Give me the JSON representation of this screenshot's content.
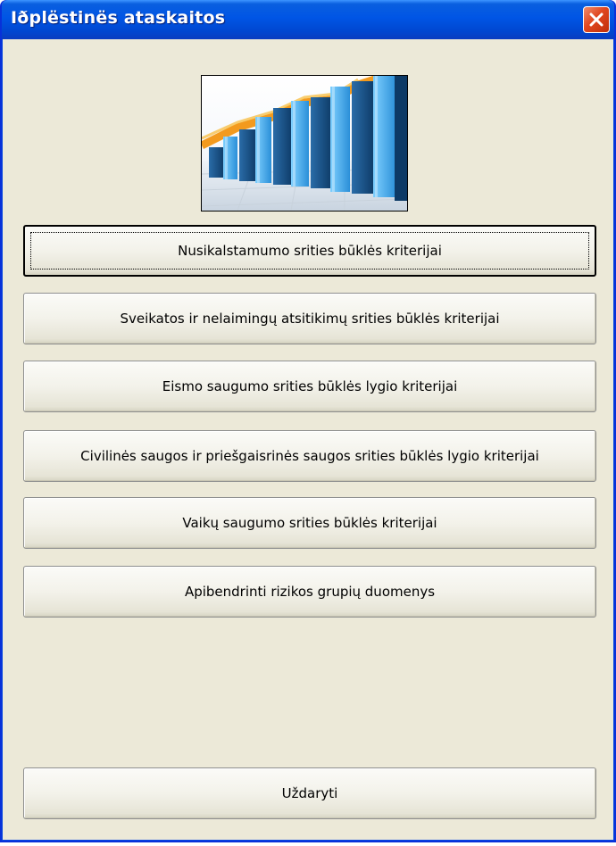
{
  "window": {
    "title": "Iðplëstinës ataskaitos"
  },
  "buttons": {
    "b1": "Nusikalstamumo srities būklės kriterijai",
    "b2": "Sveikatos ir nelaimingų atsitikimų srities būklės kriterijai",
    "b3": "Eismo saugumo srities būklės lygio kriterijai",
    "b4": "Civilinės saugos ir priešgaisrinės saugos srities būklės lygio kriterijai",
    "b5": "Vaikų saugumo srities būklės kriterijai",
    "b6": "Apibendrinti rizikos grupių duomenys",
    "close": "Uždaryti"
  },
  "icons": {
    "close": "close-icon",
    "header_image": "bar-chart-image"
  },
  "colors": {
    "titlebar": "#0055e5",
    "close_button": "#e0461f",
    "window_bg": "#ece9d8"
  }
}
